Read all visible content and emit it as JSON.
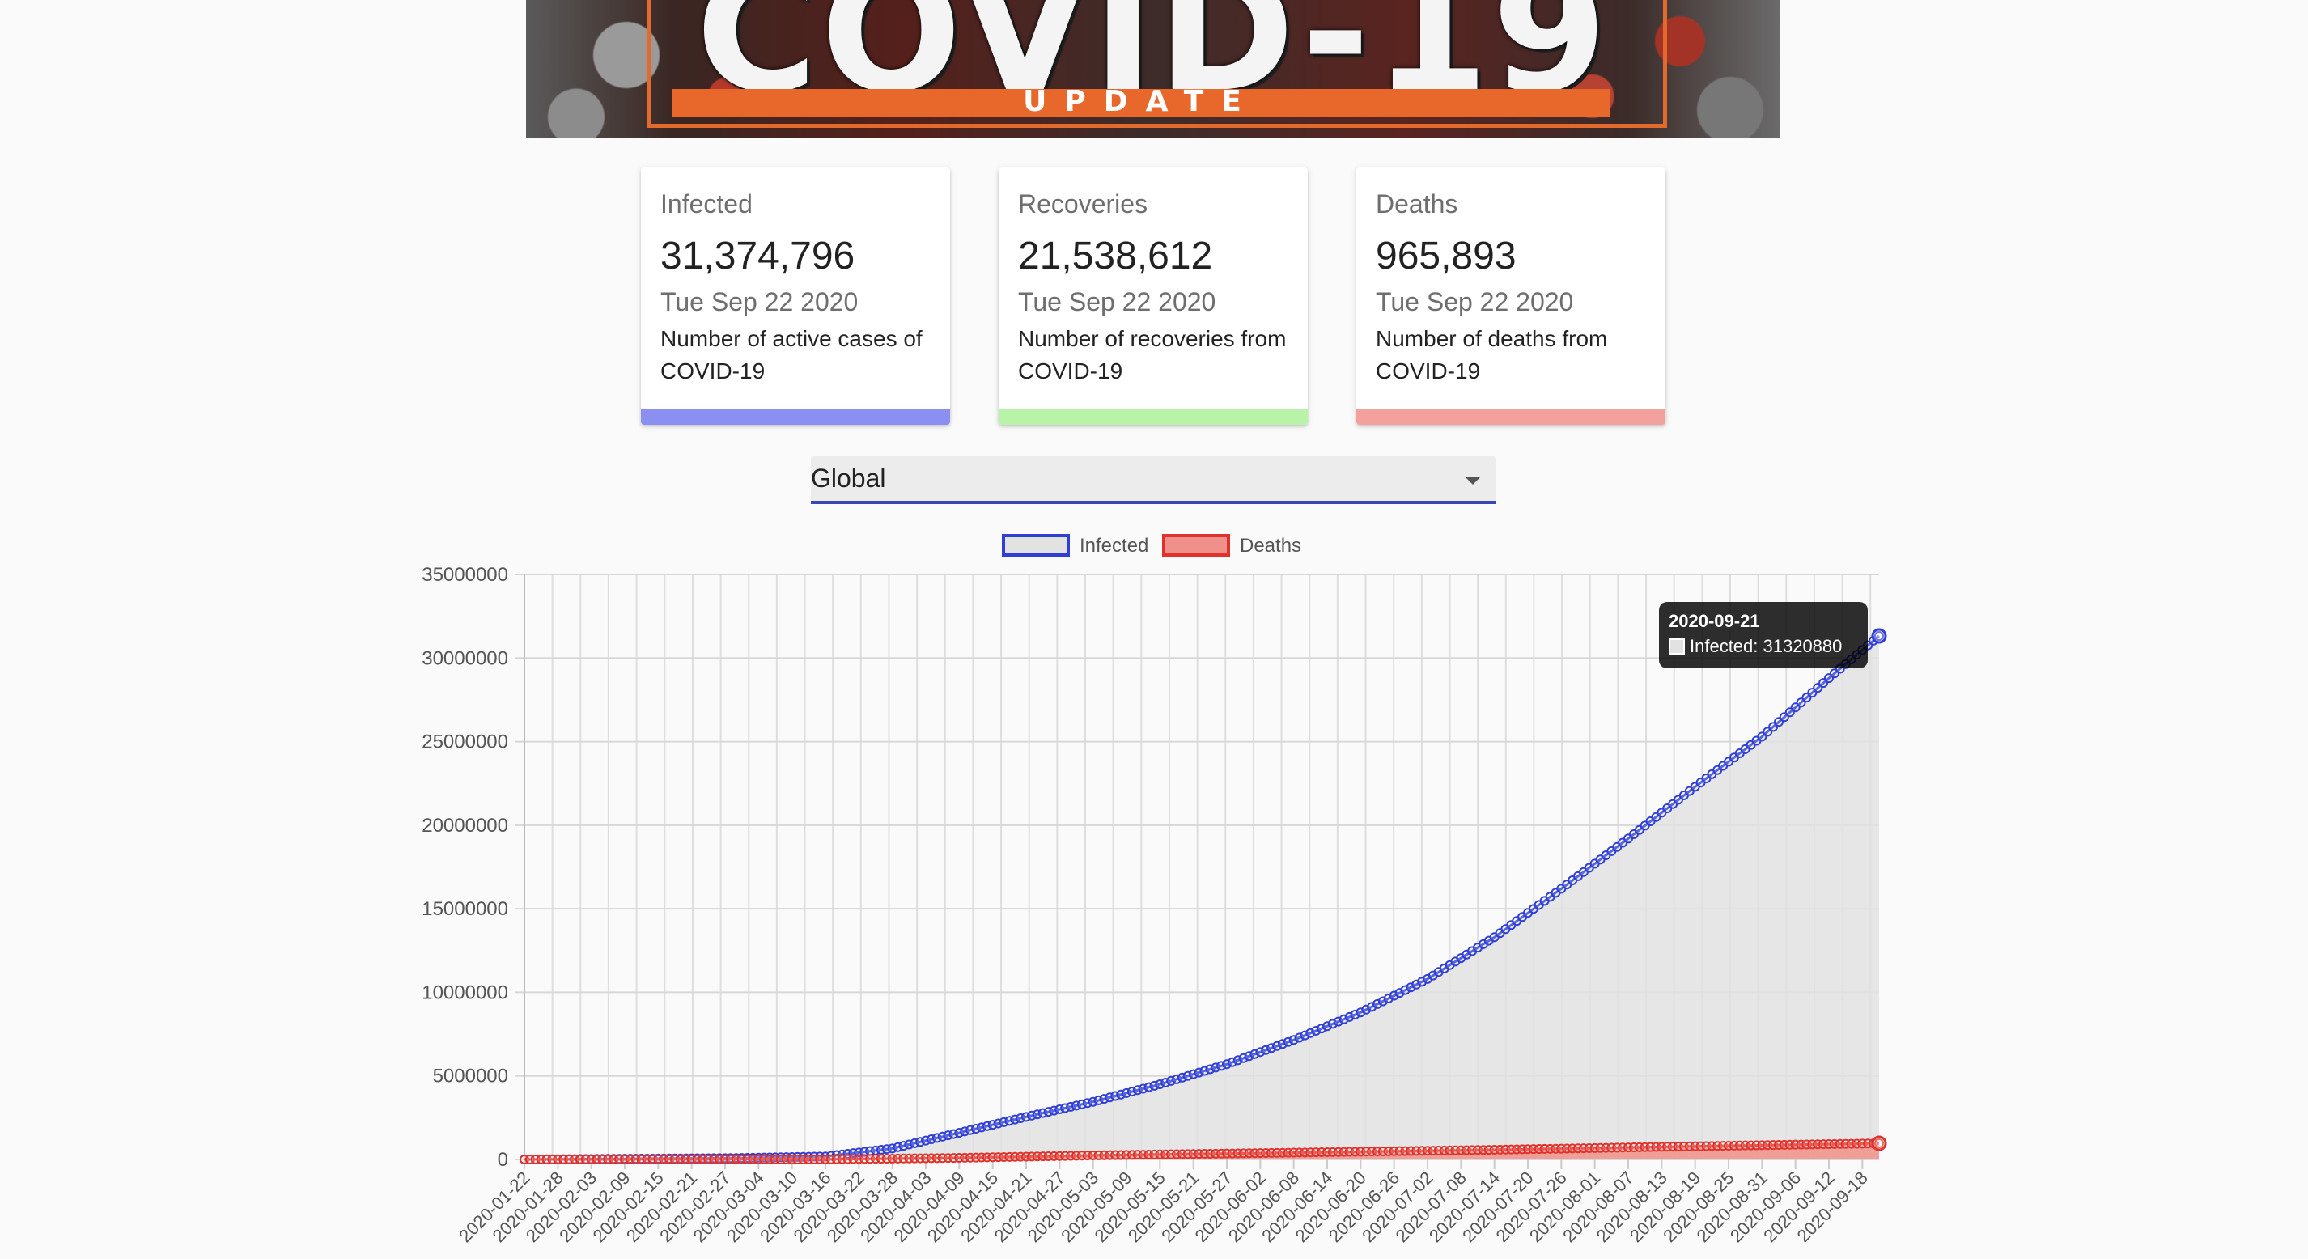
{
  "banner": {
    "title": "COVID-19",
    "subtitle": "UPDATE"
  },
  "cards": [
    {
      "label": "Infected",
      "value": "31,374,796",
      "date": "Tue Sep 22 2020",
      "description": "Number of active cases of COVID-19",
      "color": "#8b8ff2"
    },
    {
      "label": "Recoveries",
      "value": "21,538,612",
      "date": "Tue Sep 22 2020",
      "description": "Number of recoveries from COVID-19",
      "color": "#b8f3a8"
    },
    {
      "label": "Deaths",
      "value": "965,893",
      "date": "Tue Sep 22 2020",
      "description": "Number of deaths from COVID-19",
      "color": "#f4a09c"
    }
  ],
  "country_select": {
    "value": "Global"
  },
  "tooltip": {
    "title": "2020-09-21",
    "text": "Infected: 31320880"
  },
  "chart_data": {
    "type": "area",
    "x_start": "2020-01-22",
    "x_end": "2020-09-21",
    "x_tick_labels": [
      "2020-01-22",
      "2020-01-28",
      "2020-02-03",
      "2020-02-09",
      "2020-02-15",
      "2020-02-21",
      "2020-02-27",
      "2020-03-04",
      "2020-03-10",
      "2020-03-16",
      "2020-03-22",
      "2020-03-28",
      "2020-04-03",
      "2020-04-09",
      "2020-04-15",
      "2020-04-21",
      "2020-04-27",
      "2020-05-03",
      "2020-05-09",
      "2020-05-15",
      "2020-05-21",
      "2020-05-27",
      "2020-06-02",
      "2020-06-08",
      "2020-06-14",
      "2020-06-20",
      "2020-06-26",
      "2020-07-02",
      "2020-07-08",
      "2020-07-14",
      "2020-07-20",
      "2020-07-26",
      "2020-08-01",
      "2020-08-07",
      "2020-08-13",
      "2020-08-19",
      "2020-08-25",
      "2020-08-31",
      "2020-09-06",
      "2020-09-12",
      "2020-09-18"
    ],
    "y_ticks": [
      0,
      5000000,
      10000000,
      15000000,
      20000000,
      25000000,
      30000000,
      35000000
    ],
    "ylim": [
      0,
      35000000
    ],
    "grid": true,
    "legend_position": "top",
    "series": [
      {
        "name": "Infected",
        "color": "#2f3fd6",
        "fill": "#e2e2e2",
        "points": [
          [
            "2020-01-22",
            555
          ],
          [
            "2020-02-09",
            40000
          ],
          [
            "2020-03-01",
            88000
          ],
          [
            "2020-03-16",
            180000
          ],
          [
            "2020-03-28",
            660000
          ],
          [
            "2020-04-09",
            1600000
          ],
          [
            "2020-04-21",
            2550000
          ],
          [
            "2020-05-03",
            3450000
          ],
          [
            "2020-05-15",
            4500000
          ],
          [
            "2020-05-27",
            5700000
          ],
          [
            "2020-06-08",
            7150000
          ],
          [
            "2020-06-20",
            8800000
          ],
          [
            "2020-07-02",
            10800000
          ],
          [
            "2020-07-14",
            13300000
          ],
          [
            "2020-07-26",
            16200000
          ],
          [
            "2020-08-07",
            19200000
          ],
          [
            "2020-08-19",
            22300000
          ],
          [
            "2020-08-31",
            25300000
          ],
          [
            "2020-09-12",
            28800000
          ],
          [
            "2020-09-21",
            31320880
          ]
        ]
      },
      {
        "name": "Deaths",
        "color": "#e0322a",
        "fill": "#f0908a",
        "points": [
          [
            "2020-01-22",
            17
          ],
          [
            "2020-03-16",
            7000
          ],
          [
            "2020-04-09",
            95000
          ],
          [
            "2020-05-03",
            245000
          ],
          [
            "2020-06-08",
            410000
          ],
          [
            "2020-07-14",
            580000
          ],
          [
            "2020-08-19",
            790000
          ],
          [
            "2020-09-21",
            967000
          ]
        ]
      }
    ]
  }
}
